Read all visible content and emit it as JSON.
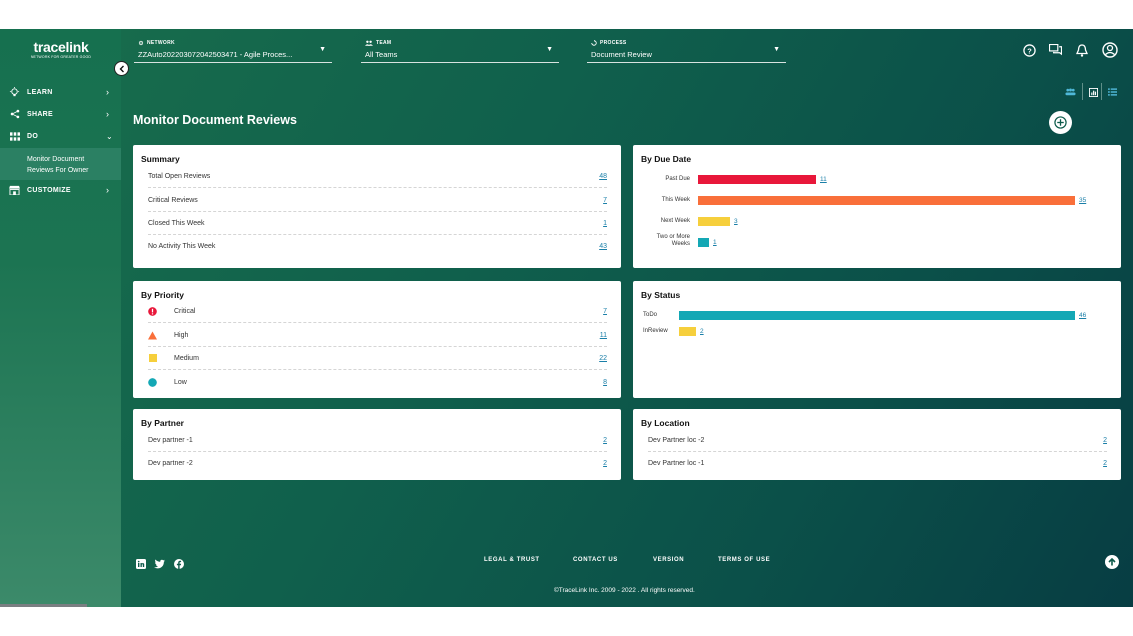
{
  "app": {
    "logo_text": "tracelink",
    "logo_tagline": "NETWORK FOR GREATER GOOD"
  },
  "sidebar": {
    "items": [
      {
        "label": "LEARN",
        "icon": "lightbulb-icon"
      },
      {
        "label": "SHARE",
        "icon": "share-icon"
      },
      {
        "label": "DO",
        "icon": "grid-icon"
      },
      {
        "label": "CUSTOMIZE",
        "icon": "store-icon"
      }
    ],
    "sub_item_line1": "Monitor Document",
    "sub_item_line2": "Reviews For Owner"
  },
  "header": {
    "network_caption": "NETWORK",
    "network_value": "ZZAuto20220307204250347​1 - Agile Proces...",
    "team_caption": "TEAM",
    "team_value": "All Teams",
    "process_caption": "PROCESS",
    "process_value": "Document Review"
  },
  "page": {
    "title": "Monitor Document Reviews"
  },
  "summary": {
    "title": "Summary",
    "rows": [
      {
        "label": "Total Open Reviews",
        "value": "48"
      },
      {
        "label": "Critical Reviews",
        "value": "7"
      },
      {
        "label": "Closed This Week",
        "value": "1"
      },
      {
        "label": "No Activity This Week",
        "value": "43"
      }
    ]
  },
  "by_due_date": {
    "title": "By Due Date",
    "bars": [
      {
        "label_line1": "Past Due",
        "label_line2": "",
        "value": 11,
        "value_text": "11",
        "color": "#e8173a"
      },
      {
        "label_line1": "This Week",
        "label_line2": "",
        "value": 35,
        "value_text": "35",
        "color": "#f96f3a"
      },
      {
        "label_line1": "Next Week",
        "label_line2": "",
        "value": 3,
        "value_text": "3",
        "color": "#f6cf3c"
      },
      {
        "label_line1": "Two or More",
        "label_line2": "Weeks",
        "value": 1,
        "value_text": "1",
        "color": "#14a8b5"
      }
    ]
  },
  "by_priority": {
    "title": "By Priority",
    "rows": [
      {
        "label": "Critical",
        "value": "7",
        "icon": "critical-icon",
        "color": "#e8173a"
      },
      {
        "label": "High",
        "value": "11",
        "icon": "high-triangle-icon",
        "color": "#f96f3a"
      },
      {
        "label": "Medium",
        "value": "22",
        "icon": "medium-square-icon",
        "color": "#f6cf3c"
      },
      {
        "label": "Low",
        "value": "8",
        "icon": "low-circle-icon",
        "color": "#14a8b5"
      }
    ]
  },
  "by_status": {
    "title": "By Status",
    "bars": [
      {
        "label": "ToDo",
        "value": 46,
        "value_text": "46",
        "color": "#14a8b5"
      },
      {
        "label": "InReview",
        "value": 2,
        "value_text": "2",
        "color": "#f6cf3c"
      }
    ]
  },
  "by_partner": {
    "title": "By Partner",
    "rows": [
      {
        "label": "Dev partner -1",
        "value": "2"
      },
      {
        "label": "Dev partner -2",
        "value": "2"
      }
    ]
  },
  "by_location": {
    "title": "By Location",
    "rows": [
      {
        "label": "Dev Partner loc -2",
        "value": "2"
      },
      {
        "label": "Dev Partner loc -1",
        "value": "2"
      }
    ]
  },
  "footer": {
    "links": [
      "LEGAL & TRUST",
      "CONTACT US",
      "VERSION",
      "TERMS OF USE"
    ],
    "copyright": "©TraceLink Inc. 2009 - 2022 . All rights reserved."
  },
  "colors": {
    "accent": "#1a7fa8",
    "sidebar_green": "#16704f"
  }
}
